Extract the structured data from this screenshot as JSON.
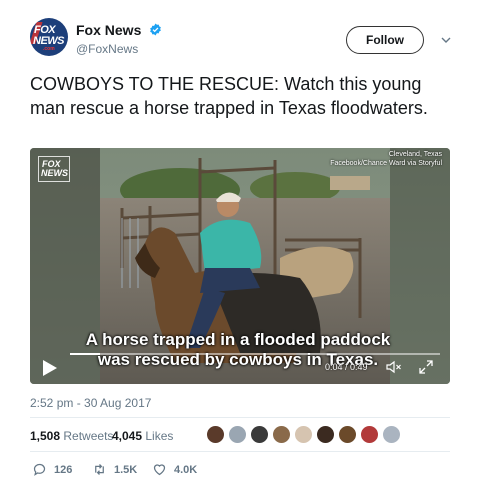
{
  "account": {
    "display_name": "Fox News",
    "handle": "@FoxNews",
    "avatar_line1": "FOX",
    "avatar_line2": "NEWS",
    "avatar_line3": ".com"
  },
  "follow_label": "Follow",
  "tweet_text": "COWBOYS TO THE RESCUE: Watch this young man rescue a horse trapped in Texas floodwaters.",
  "video": {
    "logo_line1": "FOX",
    "logo_line2": "NEWS",
    "credit_location": "Cleveland, Texas",
    "credit_source": "Facebook/Chance Ward via Storyful",
    "caption_line1": "A horse trapped in a flooded paddock",
    "caption_line2": "was rescued by cowboys in Texas.",
    "time": "0:04 / 0:49",
    "progress": 0.08
  },
  "timestamp": "2:52 pm - 30 Aug 2017",
  "stats": {
    "retweets_count": "1,508",
    "retweets_label": "Retweets",
    "likes_count": "4,045",
    "likes_label": "Likes",
    "liker_colors": [
      "#5a3a2a",
      "#9aa6b2",
      "#3a3a3a",
      "#8a6a4a",
      "#d6c4b0",
      "#3b2a20",
      "#6b4a2a",
      "#b23a3a",
      "#aab4c0"
    ]
  },
  "actions": {
    "replies": "126",
    "retweets": "1.5K",
    "likes": "4.0K"
  },
  "colors": {
    "verified": "#1da1f2",
    "secondary_text": "#657786",
    "primary_text": "#14171a"
  }
}
